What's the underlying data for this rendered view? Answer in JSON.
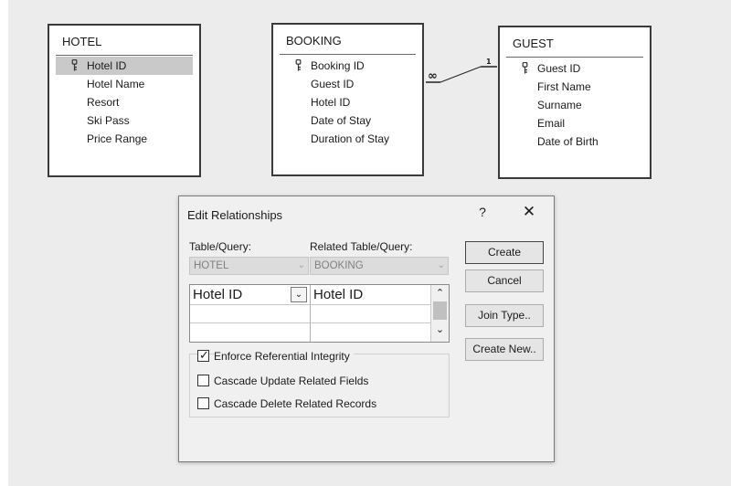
{
  "diagram": {
    "tables": {
      "hotel": {
        "title": "HOTEL",
        "fields": [
          "Hotel ID",
          "Hotel Name",
          "Resort",
          "Ski Pass",
          "Price Range"
        ],
        "key_field": "Hotel ID",
        "selected_field": "Hotel ID"
      },
      "booking": {
        "title": "BOOKING",
        "fields": [
          "Booking ID",
          "Guest ID",
          "Hotel ID",
          "Date of Stay",
          "Duration of Stay"
        ],
        "key_field": "Booking ID"
      },
      "guest": {
        "title": "GUEST",
        "fields": [
          "Guest ID",
          "First Name",
          "Surname",
          "Email",
          "Date of Birth"
        ],
        "key_field": "Guest ID"
      }
    },
    "relationship": {
      "from_table": "BOOKING",
      "to_table": "GUEST",
      "many_symbol": "∞",
      "one_symbol": "1"
    }
  },
  "dialog": {
    "title": "Edit Relationships",
    "help_glyph": "?",
    "close_glyph": "✕",
    "table_query_label": "Table/Query:",
    "related_table_query_label": "Related Table/Query:",
    "table_value": "HOTEL",
    "related_value": "BOOKING",
    "grid_row_1_left": "Hotel ID",
    "grid_row_1_right": "Hotel ID",
    "checkboxes": {
      "enforce": {
        "label": "Enforce Referential Integrity",
        "checked": true
      },
      "cascade_update": {
        "label": "Cascade Update Related Fields",
        "checked": false
      },
      "cascade_delete": {
        "label": "Cascade Delete Related Records",
        "checked": false
      }
    },
    "buttons": {
      "create": "Create",
      "cancel": "Cancel",
      "join_type": "Join Type..",
      "create_new": "Create New.."
    }
  }
}
